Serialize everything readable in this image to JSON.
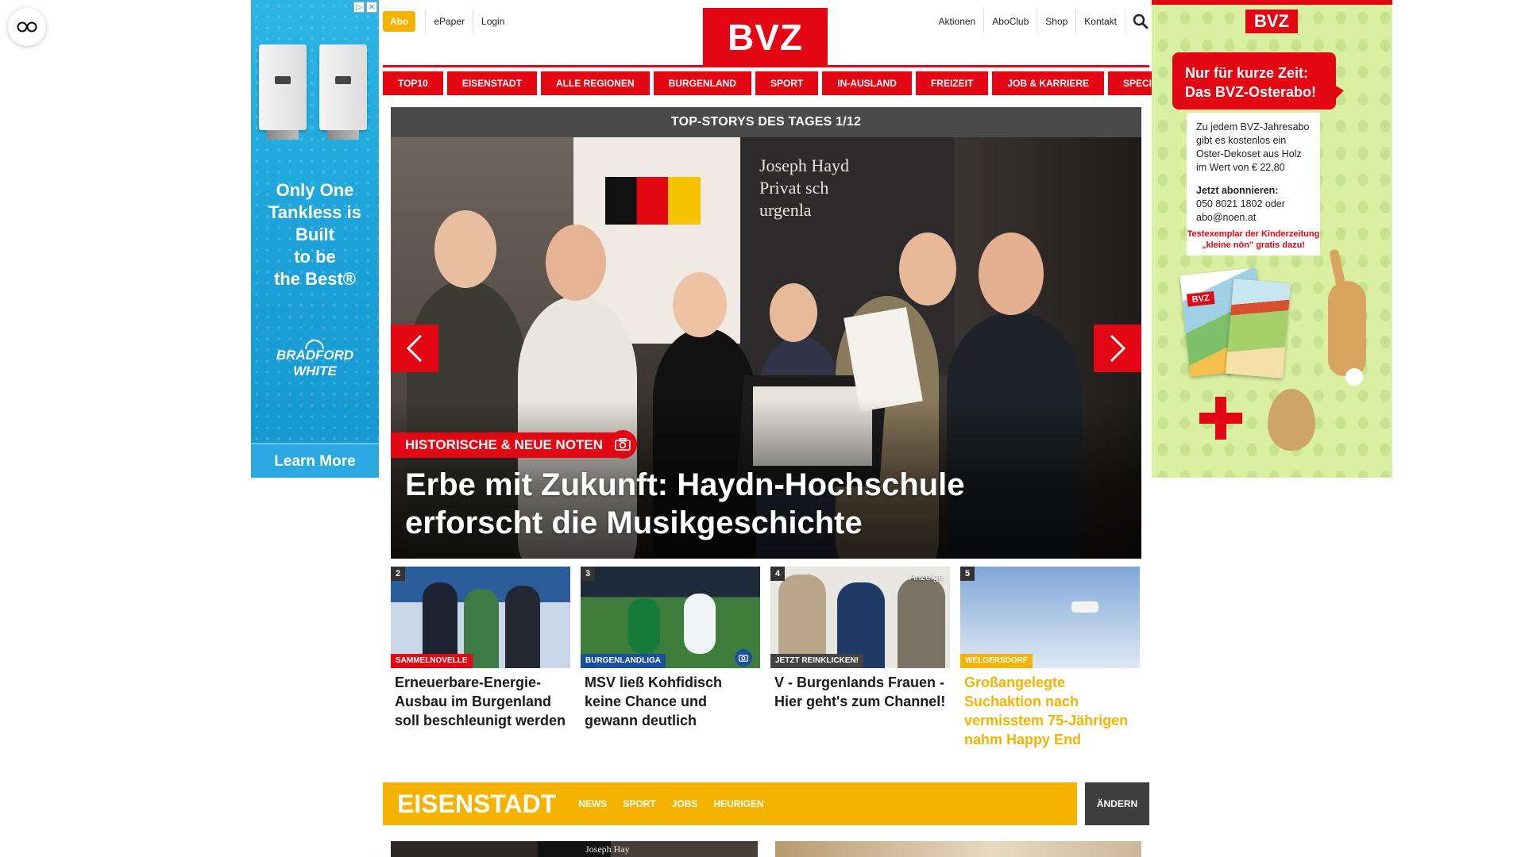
{
  "left_ad": {
    "adchoices": [
      "▷",
      "✕"
    ],
    "headline": "Only One\nTankless is\nBuilt\nto be\nthe Best®",
    "brand": "BRADFORD\nWHITE",
    "cta": "Learn More"
  },
  "header": {
    "abo": "Abo",
    "left_links": [
      "ePaper",
      "Login"
    ],
    "logo": "BVZ",
    "right_links": [
      "Aktionen",
      "AboClub",
      "Shop",
      "Kontakt"
    ]
  },
  "nav": [
    "TOP10",
    "EISENSTADT",
    "ALLE REGIONEN",
    "BURGENLAND",
    "SPORT",
    "IN-AUSLAND",
    "FREIZEIT",
    "JOB & KARRIERE",
    "SPECIALS"
  ],
  "top_stories": {
    "heading": "TOP-STORYS DES TAGES 1/12",
    "hero": {
      "kicker": "HISTORISCHE & NEUE NOTEN",
      "title": "Erbe mit Zukunft: Haydn-Hochschule erforscht die Musikgeschichte",
      "banner_text": "Joseph Hayd\nPrivat   sch\n          urgenla"
    },
    "teasers": [
      {
        "num": "2",
        "tag": "SAMMELNOVELLE",
        "title": "Erneuerbare-Energie-Ausbau im Burgenland soll beschleunigt werden"
      },
      {
        "num": "3",
        "tag": "BURGENLANDLIGA",
        "title": "MSV ließ Kohfidisch keine Chance und gewann deutlich"
      },
      {
        "num": "4",
        "tag": "JETZT REINKLICKEN!",
        "title": "V - Burgenlands Frauen - Hier geht's zum Channel!",
        "ad_label": "Anzeige"
      },
      {
        "num": "5",
        "tag": "WELGERSDORF",
        "title": "Großangelegte Suchaktion nach vermisstem 75-Jährigen nahm Happy End"
      }
    ]
  },
  "region": {
    "name": "EISENSTADT",
    "links": [
      "NEWS",
      "SPORT",
      "JOBS",
      "HEURIGEN"
    ],
    "change": "ÄNDERN",
    "preview_text": "Joseph Hay"
  },
  "right_ad": {
    "logo": "BVZ",
    "bubble": "Nur für kurze Zeit:\nDas BVZ-Osterabo!",
    "p1": "Zu jedem BVZ-Jahresabo\ngibt es kostenlos ein\nOster-Dekoset aus Holz\nim Wert von € 22,80",
    "p2": "Jetzt abonnieren:",
    "p3": "050 8021 1802 oder\nabo@noen.at",
    "promo": "Testexemplar der Kinderzeitung\n„kleine nön\" gratis dazu!",
    "mag_logo": "BVZ"
  },
  "colors": {
    "brand_red": "#e30613",
    "region_yellow": "#f5b300",
    "dark_bar": "#4a4a4a"
  }
}
